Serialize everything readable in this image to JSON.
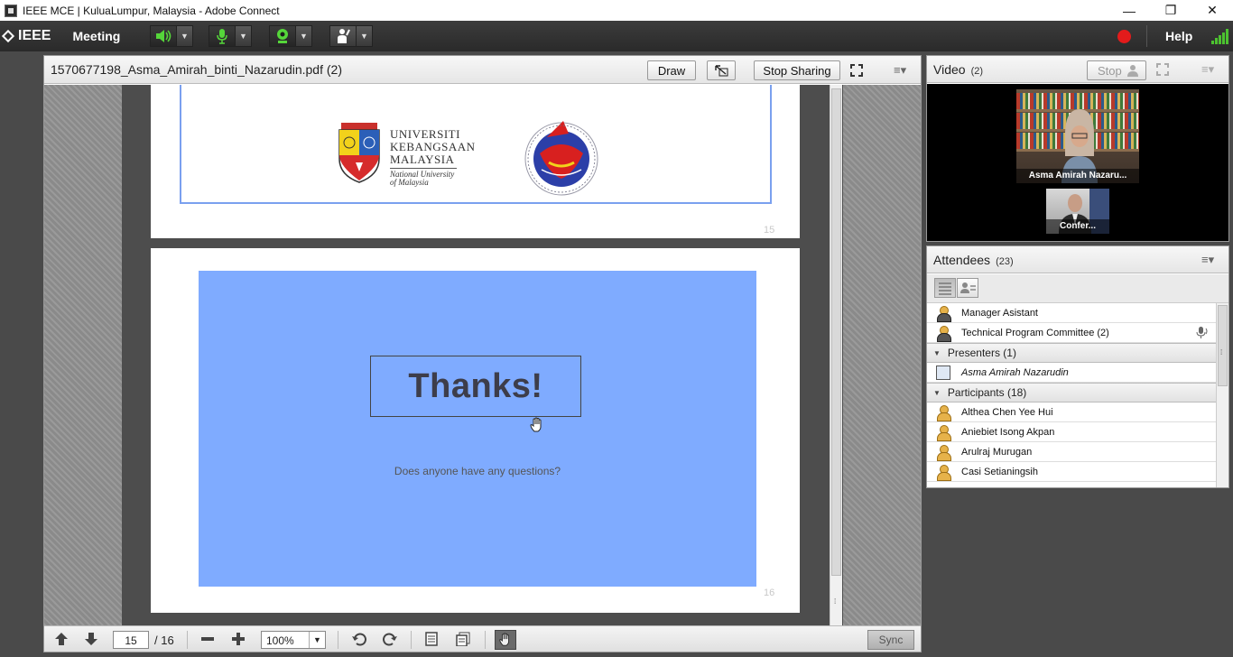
{
  "window": {
    "title": "IEEE MCE | KuluaLumpur, Malaysia - Adobe Connect",
    "minimize": "—",
    "maximize": "❐",
    "close": "✕"
  },
  "menubar": {
    "logo": "IEEE",
    "meeting": "Meeting",
    "help": "Help",
    "icons": [
      "speaker-icon",
      "microphone-icon",
      "webcam-icon",
      "raise-hand-icon"
    ],
    "record_color": "#e31b1b"
  },
  "share_pod": {
    "title": "1570677198_Asma_Amirah_binti_Nazarudin.pdf (2)",
    "draw_label": "Draw",
    "stop_sharing_label": "Stop Sharing",
    "pages": {
      "page15": {
        "number": "15",
        "ukm_lines": [
          "UNIVERSITI",
          "KEBANGSAAN",
          "MALAYSIA"
        ],
        "ukm_sub": [
          "National University",
          "of Malaysia"
        ]
      },
      "page16": {
        "number": "16",
        "title": "Thanks!",
        "subtitle": "Does anyone have any questions?",
        "background": "#7fabff"
      }
    },
    "footer": {
      "current_page": "15",
      "total_pages": "/ 16",
      "zoom": "100%",
      "sync_label": "Sync"
    }
  },
  "video_pod": {
    "title": "Video",
    "count": "(2)",
    "stop_label": "Stop",
    "main_cam_label": "Asma Amirah Nazaru...",
    "small_cam_label": "Confer..."
  },
  "attendees_pod": {
    "title": "Attendees",
    "count": "(23)",
    "rows": [
      {
        "type": "host",
        "name": "Manager Asistant"
      },
      {
        "type": "host",
        "name": "Technical Program Committee (2)"
      }
    ],
    "groups": {
      "presenters": {
        "label": "Presenters (1)",
        "members": [
          "Asma Amirah  Nazarudin"
        ]
      },
      "participants": {
        "label": "Participants (18)",
        "members": [
          "Althea Chen Yee  Hui",
          "Aniebiet Isong  Akpan",
          "Arulraj Murugan",
          "Casi  Setianingsih"
        ]
      }
    }
  }
}
